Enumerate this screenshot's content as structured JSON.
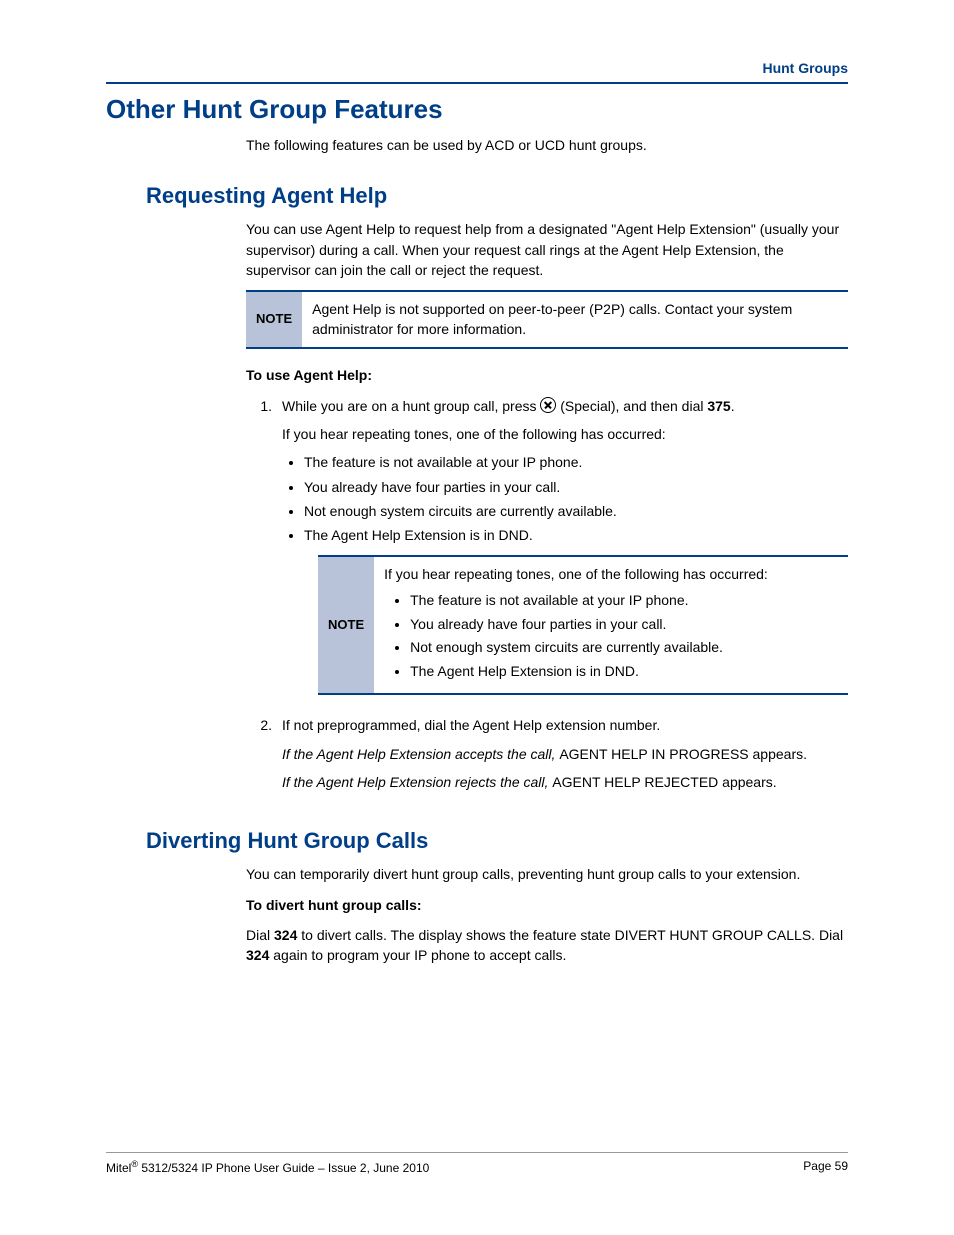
{
  "header": {
    "category": "Hunt Groups"
  },
  "h1": "Other Hunt Group Features",
  "intro": "The following features can be used by ACD or UCD hunt groups.",
  "section1": {
    "title": "Requesting Agent Help",
    "para1": "You can use Agent Help to request help from a designated \"Agent Help Extension\" (usually your supervisor) during a call. When your request call rings at the Agent Help Extension, the supervisor can join the call or reject the request.",
    "note1": {
      "label": "NOTE",
      "text": "Agent Help is not supported on peer-to-peer (P2P) calls. Contact your system administrator for more information."
    },
    "subhead": "To use Agent Help:",
    "step1": {
      "num": "1.",
      "pre": "While you are on a hunt group call, press ",
      "post_icon": " (Special), and then dial ",
      "code": "375",
      "after_code": ".",
      "line2": "If you hear repeating tones, one of the following has occurred:",
      "bullets": [
        "The feature is not available at your IP phone.",
        "You already have four parties in your call.",
        "Not enough system circuits are currently available.",
        "The Agent Help Extension is in DND."
      ]
    },
    "note2": {
      "label": "NOTE",
      "lead": "If you hear repeating tones, one of the following has occurred:",
      "bullets": [
        "The feature is not available at your IP phone.",
        "You already have four parties in your call.",
        "Not enough system circuits are currently available.",
        "The Agent Help Extension is in DND."
      ]
    },
    "step2": {
      "num": "2.",
      "line1": "If not preprogrammed, dial the Agent Help extension number.",
      "accept_i": "If the Agent Help Extension accepts the call, ",
      "accept_r": "AGENT HELP IN PROGRESS appears.",
      "reject_i": "If the Agent Help Extension rejects the call, ",
      "reject_r": "AGENT HELP REJECTED appears."
    }
  },
  "section2": {
    "title": "Diverting Hunt Group Calls",
    "para1": "You can temporarily divert hunt group calls, preventing hunt group calls to your extension.",
    "subhead": "To divert hunt group calls:",
    "body_pre": "Dial ",
    "code1": "324",
    "body_mid": " to divert calls. The display shows the feature state DIVERT HUNT GROUP CALLS. Dial ",
    "code2": "324",
    "body_post": " again to program your IP phone to accept calls."
  },
  "footer": {
    "left_pre": "Mitel",
    "left_post": " 5312/5324 IP Phone User Guide  – Issue 2, June 2010",
    "right": "Page 59"
  }
}
